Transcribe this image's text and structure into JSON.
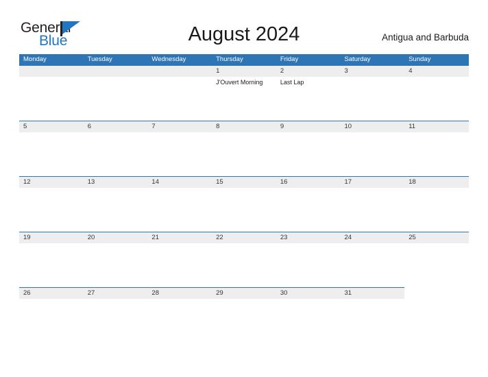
{
  "brand": {
    "name_part1": "General",
    "name_part2": "Blue",
    "primary_color": "#1f76c2",
    "flag_icon": "triangle-flag-icon"
  },
  "header": {
    "title": "August 2024",
    "region": "Antigua and Barbuda"
  },
  "calendar": {
    "month": "August",
    "year": "2024",
    "header_color": "#2e75b6",
    "band_color": "#eeeeee",
    "weekdays": [
      "Monday",
      "Tuesday",
      "Wednesday",
      "Thursday",
      "Friday",
      "Saturday",
      "Sunday"
    ],
    "weeks": [
      {
        "band_columns": 7,
        "days": [
          {
            "number": "",
            "events": []
          },
          {
            "number": "",
            "events": []
          },
          {
            "number": "",
            "events": []
          },
          {
            "number": "1",
            "events": [
              "J'Ouvert Morning"
            ]
          },
          {
            "number": "2",
            "events": [
              "Last Lap"
            ]
          },
          {
            "number": "3",
            "events": []
          },
          {
            "number": "4",
            "events": []
          }
        ]
      },
      {
        "band_columns": 7,
        "days": [
          {
            "number": "5",
            "events": []
          },
          {
            "number": "6",
            "events": []
          },
          {
            "number": "7",
            "events": []
          },
          {
            "number": "8",
            "events": []
          },
          {
            "number": "9",
            "events": []
          },
          {
            "number": "10",
            "events": []
          },
          {
            "number": "11",
            "events": []
          }
        ]
      },
      {
        "band_columns": 7,
        "days": [
          {
            "number": "12",
            "events": []
          },
          {
            "number": "13",
            "events": []
          },
          {
            "number": "14",
            "events": []
          },
          {
            "number": "15",
            "events": []
          },
          {
            "number": "16",
            "events": []
          },
          {
            "number": "17",
            "events": []
          },
          {
            "number": "18",
            "events": []
          }
        ]
      },
      {
        "band_columns": 7,
        "days": [
          {
            "number": "19",
            "events": []
          },
          {
            "number": "20",
            "events": []
          },
          {
            "number": "21",
            "events": []
          },
          {
            "number": "22",
            "events": []
          },
          {
            "number": "23",
            "events": []
          },
          {
            "number": "24",
            "events": []
          },
          {
            "number": "25",
            "events": []
          }
        ]
      },
      {
        "band_columns": 6,
        "days": [
          {
            "number": "26",
            "events": []
          },
          {
            "number": "27",
            "events": []
          },
          {
            "number": "28",
            "events": []
          },
          {
            "number": "29",
            "events": []
          },
          {
            "number": "30",
            "events": []
          },
          {
            "number": "31",
            "events": []
          },
          {
            "number": "",
            "events": []
          }
        ]
      }
    ]
  }
}
